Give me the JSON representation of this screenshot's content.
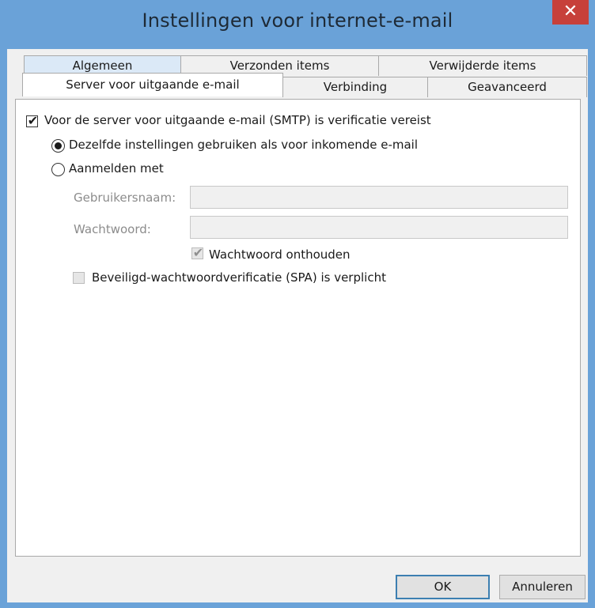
{
  "window": {
    "title": "Instellingen voor internet-e-mail",
    "close_glyph": "✕"
  },
  "tabs": {
    "row1": [
      "Algemeen",
      "Verzonden items",
      "Verwijderde items"
    ],
    "row2": [
      "Server voor uitgaande e-mail",
      "Verbinding",
      "Geavanceerd"
    ],
    "active": "Server voor uitgaande e-mail"
  },
  "smtp": {
    "requires_auth_label": "Voor de server voor uitgaande e-mail (SMTP) is verificatie vereist",
    "requires_auth_checked": true,
    "same_settings_label": "Dezelfde instellingen gebruiken als voor inkomende e-mail",
    "same_settings_selected": true,
    "login_with_label": "Aanmelden met",
    "login_with_selected": false,
    "username_label": "Gebruikersnaam:",
    "username_value": "",
    "password_label": "Wachtwoord:",
    "password_value": "",
    "remember_password_label": "Wachtwoord onthouden",
    "remember_password_checked": true,
    "spa_label": "Beveiligd-wachtwoordverificatie (SPA) is verplicht",
    "spa_checked": false
  },
  "buttons": {
    "ok": "OK",
    "cancel": "Annuleren"
  },
  "icons": {
    "check": "✔"
  },
  "colors": {
    "titlebar": "#6aa2d8",
    "close": "#c7403a",
    "default_button_border": "#3c7fb1"
  }
}
